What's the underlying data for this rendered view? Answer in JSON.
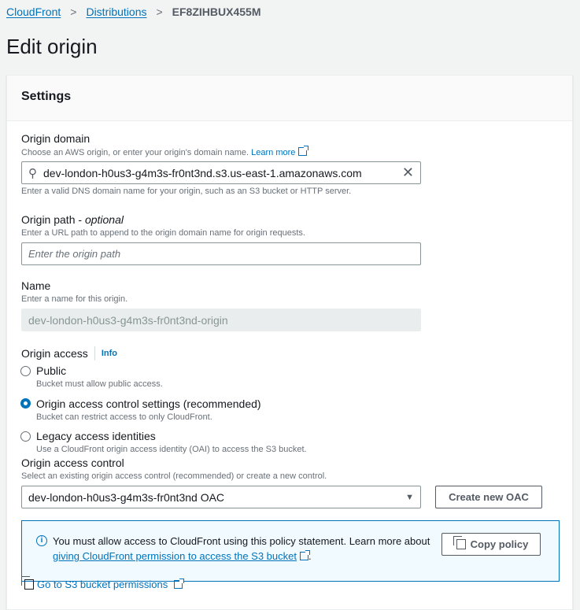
{
  "breadcrumb": {
    "items": [
      "CloudFront",
      "Distributions"
    ],
    "current": "EF8ZIHBUX455M"
  },
  "page_title": "Edit origin",
  "settings": {
    "title": "Settings",
    "origin_domain": {
      "label": "Origin domain",
      "description": "Choose an AWS origin, or enter your origin's domain name.",
      "learn_more": "Learn more",
      "value": "dev-london-h0us3-g4m3s-fr0nt3nd.s3.us-east-1.amazonaws.com",
      "hint": "Enter a valid DNS domain name for your origin, such as an S3 bucket or HTTP server."
    },
    "origin_path": {
      "label": "Origin path",
      "optional": "optional",
      "description": "Enter a URL path to append to the origin domain name for origin requests.",
      "placeholder": "Enter the origin path"
    },
    "name": {
      "label": "Name",
      "description": "Enter a name for this origin.",
      "value": "dev-london-h0us3-g4m3s-fr0nt3nd-origin"
    },
    "origin_access": {
      "label": "Origin access",
      "info": "Info",
      "options": [
        {
          "label": "Public",
          "description": "Bucket must allow public access.",
          "selected": false
        },
        {
          "label": "Origin access control settings (recommended)",
          "description": "Bucket can restrict access to only CloudFront.",
          "selected": true
        },
        {
          "label": "Legacy access identities",
          "description": "Use a CloudFront origin access identity (OAI) to access the S3 bucket.",
          "selected": false
        }
      ]
    },
    "oac": {
      "label": "Origin access control",
      "description": "Select an existing origin access control (recommended) or create a new control.",
      "selected": "dev-london-h0us3-g4m3s-fr0nt3nd OAC",
      "create_button": "Create new OAC"
    },
    "alert": {
      "text": "You must allow access to CloudFront using this policy statement. Learn more about",
      "link": "giving CloudFront permission to access the S3 bucket",
      "copy_button": "Copy policy"
    },
    "bucket_link": "Go to S3 bucket permissions"
  }
}
